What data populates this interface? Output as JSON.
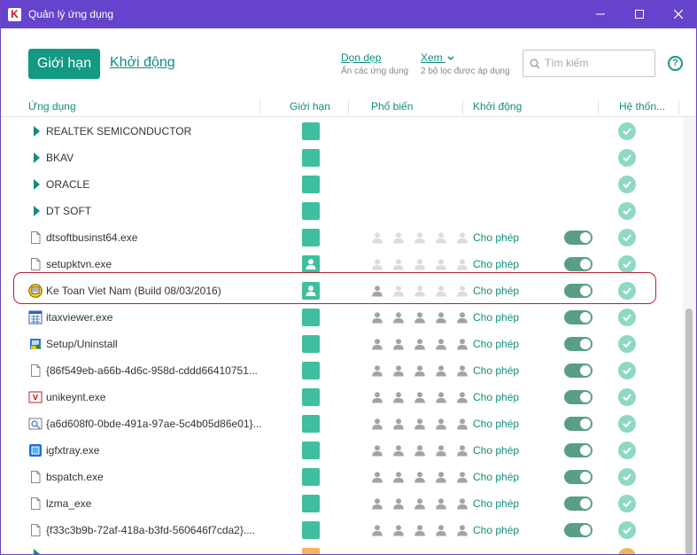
{
  "window": {
    "title": "Quản lý ứng dụng",
    "colors": {
      "titlebar": "#6543cc",
      "accent": "#129a83",
      "link": "#0f8f7a",
      "highlight": "#b22234"
    }
  },
  "toolbar": {
    "limit_button": "Giới hạn",
    "startup_link": "Khởi động",
    "cleanup_link": "Dọn dẹp",
    "cleanup_sub": "Ẩn các ứng dụng",
    "view_link": "Xem",
    "view_sub": "2 bộ lọc được áp dụng",
    "search_placeholder": "Tìm kiếm",
    "help": "?"
  },
  "columns": [
    "Ứng dụng",
    "Giới hạn",
    "Phổ biến",
    "Khởi động",
    "Hệ thốn..."
  ],
  "rows": [
    {
      "name": "REALTEK SEMICONDUCTOR",
      "kind": "group",
      "icon": "expand-arrow-icon",
      "limit": "square",
      "popularity": null,
      "startup": "",
      "toggle": false,
      "system": true
    },
    {
      "name": "BKAV",
      "kind": "group",
      "icon": "expand-arrow-icon",
      "limit": "square",
      "popularity": null,
      "startup": "",
      "toggle": false,
      "system": true
    },
    {
      "name": "ORACLE",
      "kind": "group",
      "icon": "expand-arrow-icon",
      "limit": "square",
      "popularity": null,
      "startup": "",
      "toggle": false,
      "system": true
    },
    {
      "name": "DT SOFT",
      "kind": "group",
      "icon": "expand-arrow-icon",
      "limit": "square",
      "popularity": null,
      "startup": "",
      "toggle": false,
      "system": true
    },
    {
      "name": "dtsoftbusinst64.exe",
      "kind": "file",
      "icon": "file-icon",
      "limit": "square",
      "popularity": 0,
      "startup": "Cho phép",
      "toggle": true,
      "system": true
    },
    {
      "name": "setupktvn.exe",
      "kind": "file",
      "icon": "file-icon",
      "limit": "user",
      "popularity": 0,
      "startup": "Cho phép",
      "toggle": true,
      "system": true
    },
    {
      "name": "Ke Toan Viet Nam (Build 08/03/2016)",
      "kind": "app",
      "icon": "ketoan-icon",
      "limit": "user",
      "popularity": 1,
      "startup": "Cho phép",
      "toggle": true,
      "system": true
    },
    {
      "name": "itaxviewer.exe",
      "kind": "app",
      "icon": "itax-icon",
      "limit": "square",
      "popularity": 5,
      "startup": "Cho phép",
      "toggle": true,
      "system": true
    },
    {
      "name": "Setup/Uninstall",
      "kind": "app",
      "icon": "setup-icon",
      "limit": "square",
      "popularity": 5,
      "startup": "Cho phép",
      "toggle": true,
      "system": true
    },
    {
      "name": "{86f549eb-a66b-4d6c-958d-cddd66410751...",
      "kind": "file",
      "icon": "file-icon",
      "limit": "square",
      "popularity": 5,
      "startup": "Cho phép",
      "toggle": true,
      "system": true
    },
    {
      "name": "unikeynt.exe",
      "kind": "app",
      "icon": "unikey-icon",
      "limit": "square",
      "popularity": 5,
      "startup": "Cho phép",
      "toggle": true,
      "system": true
    },
    {
      "name": "{a6d608f0-0bde-491a-97ae-5c4b05d86e01}...",
      "kind": "app",
      "icon": "component-icon",
      "limit": "square",
      "popularity": 5,
      "startup": "Cho phép",
      "toggle": true,
      "system": true
    },
    {
      "name": "igfxtray.exe",
      "kind": "app",
      "icon": "intel-icon",
      "limit": "square",
      "popularity": 5,
      "startup": "Cho phép",
      "toggle": true,
      "system": true
    },
    {
      "name": "bspatch.exe",
      "kind": "file",
      "icon": "file-icon",
      "limit": "square",
      "popularity": 5,
      "startup": "Cho phép",
      "toggle": true,
      "system": true
    },
    {
      "name": "lzma_exe",
      "kind": "file",
      "icon": "file-icon",
      "limit": "square",
      "popularity": 5,
      "startup": "Cho phép",
      "toggle": true,
      "system": true
    },
    {
      "name": "{f33c3b9b-72af-418a-b3fd-560646f7cda2}....",
      "kind": "file",
      "icon": "file-icon",
      "limit": "square",
      "popularity": 5,
      "startup": "Cho phép",
      "toggle": true,
      "system": true
    }
  ]
}
